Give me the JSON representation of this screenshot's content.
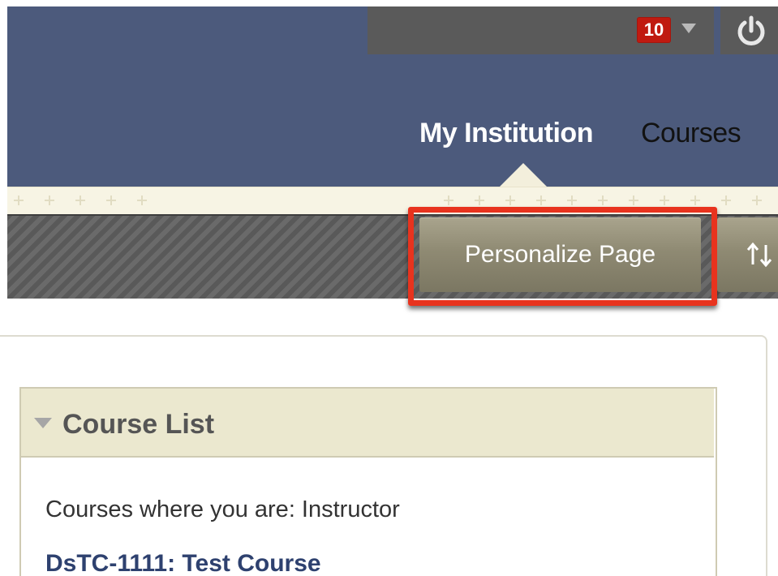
{
  "header": {
    "notification_count": "10",
    "nav": {
      "my_institution": "My Institution",
      "courses": "Courses"
    },
    "icons": {
      "notification_caret": "chevron-down-icon",
      "power": "power-icon"
    }
  },
  "toolbar": {
    "personalize_label": "Personalize Page",
    "reorder_icon": "reorder-arrows-icon"
  },
  "course_list_module": {
    "title": "Course List",
    "role_heading": "Courses where you are: Instructor",
    "courses": [
      {
        "label": "DsTC-1111: Test Course"
      }
    ]
  },
  "colors": {
    "header_bg": "#4c5a7c",
    "utility_bar_bg": "#5a5a5a",
    "badge_red": "#c01a10",
    "button_olive": "#8f8a73",
    "highlight_red": "#e8331e",
    "module_header_bg": "#ebe8cf",
    "link_navy": "#2e416f"
  }
}
